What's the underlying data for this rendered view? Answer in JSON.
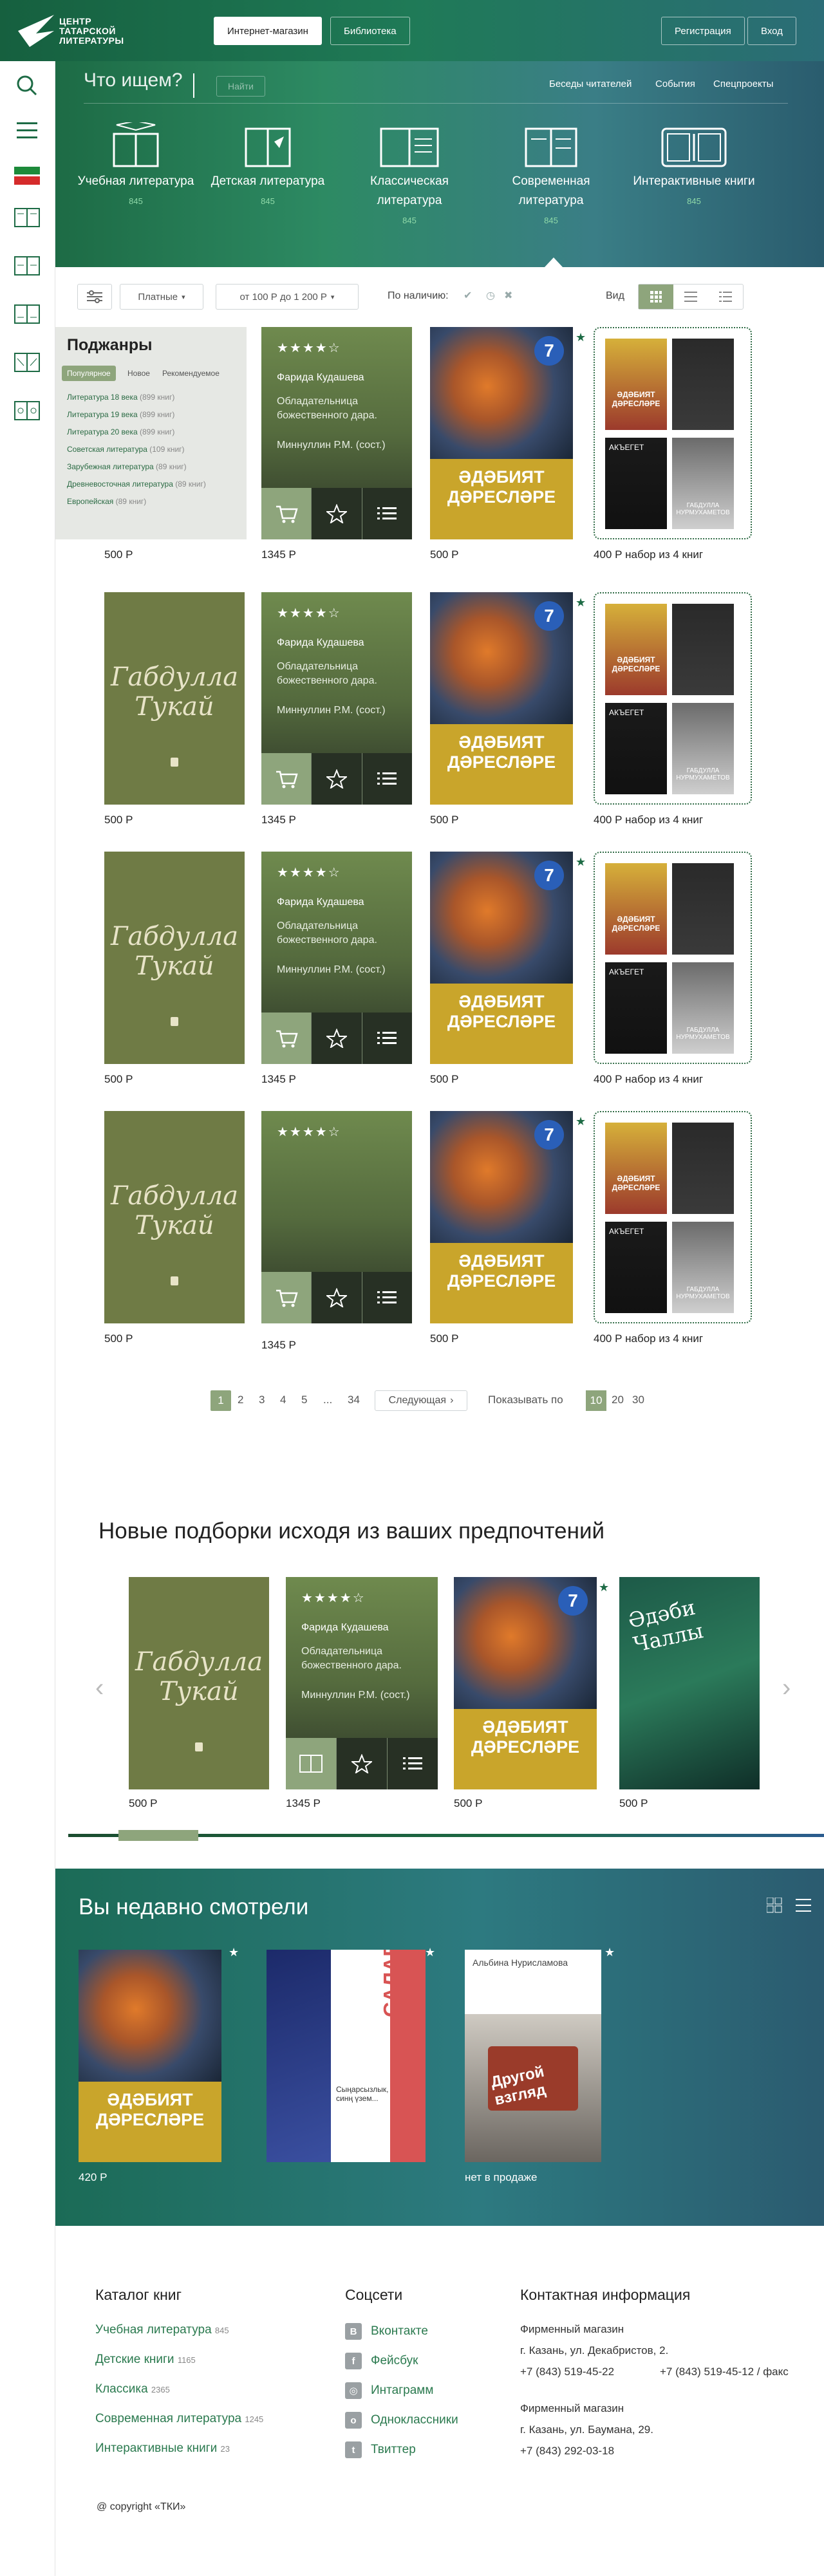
{
  "brand": {
    "logo": [
      "ЦЕНТР",
      "ТАТАРСКОЙ",
      "ЛИТЕРАТУРЫ"
    ]
  },
  "top_tabs": [
    {
      "label": "Интернет-магазин",
      "active": true
    },
    {
      "label": "Библиотека",
      "active": false
    }
  ],
  "auth": {
    "register": "Регистрация",
    "login": "Вход"
  },
  "search": {
    "placeholder": "Что ищем?",
    "button": "Найти"
  },
  "top_links": [
    "Беседы читателей",
    "События",
    "Спецпроекты"
  ],
  "categories": [
    {
      "name": "Учебная литература",
      "count": "845",
      "icon": "graduation-book-icon"
    },
    {
      "name": "Детская литература",
      "count": "845",
      "icon": "kids-book-icon"
    },
    {
      "name": "Классическая литература",
      "count": "845",
      "icon": "classic-book-icon"
    },
    {
      "name": "Современная литература",
      "count": "845",
      "icon": "modern-book-icon"
    },
    {
      "name": "Интерактивные книги",
      "count": "845",
      "icon": "interactive-book-icon"
    }
  ],
  "filters": {
    "paid": "Платные",
    "price": "от 100 Р до 1 200 Р",
    "availability": "По наличию:",
    "view": "Вид"
  },
  "subgenres": {
    "title": "Поджанры",
    "tabs": [
      "Популярное",
      "Новое",
      "Рекомендуемое"
    ],
    "items": [
      {
        "name": "Литература 18 века",
        "count": "(899 книг)"
      },
      {
        "name": "Литература 19 века",
        "count": "(899 книг)"
      },
      {
        "name": "Литература 20 века",
        "count": "(899 книг)"
      },
      {
        "name": "Советская литература",
        "count": "(109 книг)"
      },
      {
        "name": "Зарубежная литература",
        "count": "(89 книг)"
      },
      {
        "name": "Древневосточная литература",
        "count": "(89 книг)"
      },
      {
        "name": "Европейская",
        "count": "(89 книг)"
      }
    ]
  },
  "cards": {
    "tukay": {
      "title": "Габдулла Тукай",
      "price": "500 Р"
    },
    "kudasheva": {
      "rating": 4,
      "author": "Фарида Кудашева",
      "title": "Обладательница божественного дара.",
      "editor": "Миннуллин Р.М. (сост.)",
      "price": "1345 Р"
    },
    "textbook": {
      "grade": "7",
      "title": "ӘДӘБИЯТ ДӘРЕСЛӘРЕ",
      "price": "500 Р"
    },
    "set": {
      "price": "400 Р набор из 4 книг"
    }
  },
  "mini_books": [
    "ӘДӘБИЯТ ДӘРЕСЛӘРЕ",
    "АКЪЕГЕТ",
    "ГАБДУЛЛА НУРМУХАМЕТОВ"
  ],
  "pagination": {
    "pages": [
      "1",
      "2",
      "3",
      "4",
      "5",
      "...",
      "34"
    ],
    "next": "Следующая",
    "per_page_label": "Показывать по",
    "per_page": [
      "10",
      "20",
      "30"
    ]
  },
  "recommend": {
    "title": "Новые подборки исходя из ваших предпочтений",
    "extra_title": "Әдәби Чаллы",
    "extra_price": "500 Р"
  },
  "recent": {
    "title": "Вы недавно смотрели",
    "items": [
      {
        "title": "ӘДӘБИЯТ ДӘРЕСЛӘРЕ",
        "price": "420 Р"
      },
      {
        "title": "САЛАВАТ РӘМИҮЛЛА",
        "subtitle": "Сыңарсызлык, синң үзем...",
        "price": ""
      },
      {
        "title": "Другой взгляд",
        "author": "Альбина Нурисламова",
        "price": "нет в продаже"
      }
    ]
  },
  "footer": {
    "catalog_title": "Каталог книг",
    "catalog": [
      {
        "name": "Учебная литература",
        "count": "845"
      },
      {
        "name": "Детские книги",
        "count": "1165"
      },
      {
        "name": "Классика",
        "count": "2365"
      },
      {
        "name": "Современная литература",
        "count": "1245"
      },
      {
        "name": "Интерактивные книги",
        "count": "23"
      }
    ],
    "social_title": "Соцсети",
    "social": [
      "Вконтакте",
      "Фейсбук",
      "Интаграмм",
      "Одноклассники",
      "Твиттер"
    ],
    "contact_title": "Контактная информация",
    "store1_title": "Фирменный магазин",
    "store1_addr": "г. Казань, ул. Декабристов, 2.",
    "store1_phone1": "+7 (843) 519-45-22",
    "store1_phone2": "+7 (843) 519-45-12 / факс",
    "store2_title": "Фирменный магазин",
    "store2_addr": "г. Казань, ул. Баумана, 29.",
    "store2_phone": "+7 (843) 292-03-18",
    "copyright": "@ copyright «ТКИ»"
  },
  "colors": {
    "brand": "#1d6b45",
    "accent": "#8fd9a8",
    "olive": "#6f7b45",
    "gold": "#c9a52b"
  }
}
